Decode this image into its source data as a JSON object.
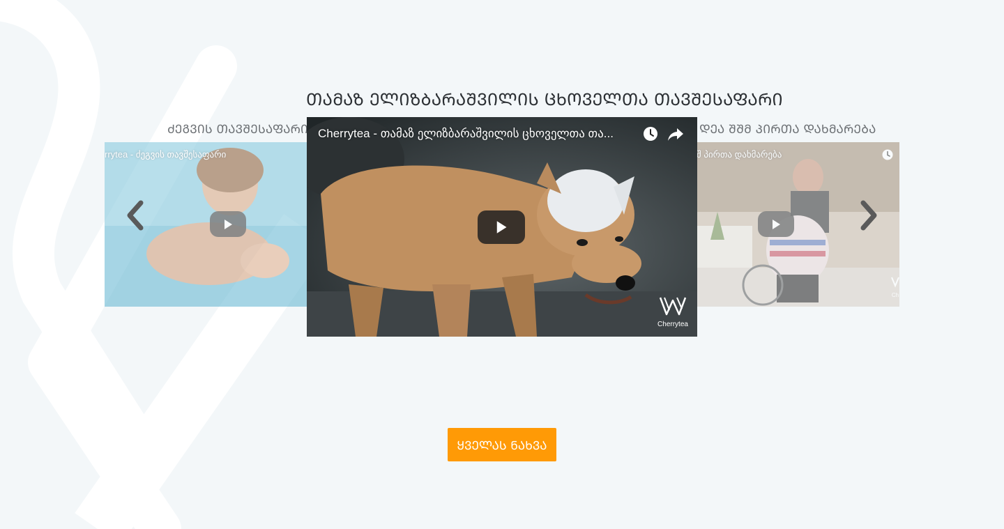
{
  "section": {
    "title": "ᲗᲐᲛᲐᲖ ᲔᲚᲘᲖᲑᲐᲠᲐᲨᲕᲘᲚᲘᲡ ᲪᲮᲝᲕᲔᲚᲗᲐ ᲗᲐᲕᲨᲔᲡᲐᲤᲐᲠᲘ"
  },
  "carousel": {
    "left": {
      "caption": "ᲫᲔᲒᲕᲘᲡ ᲗᲐᲕᲨᲔᲡᲐᲤᲐᲠᲘ",
      "video_title": "rrytea - ძეგვის თავშესაფარი"
    },
    "center": {
      "video_title": "Cherrytea - თამაზ ელიზბარაშვილის ცხოველთა თა...",
      "brand": "Cherrytea"
    },
    "right": {
      "caption": "ᲓᲔᲐ ᲨᲨᲛ ᲞᲘᲠᲗᲐ ᲓᲐᲮᲛᲐᲠᲔᲑᲐ",
      "video_title": "შ პირთა დახმარება",
      "brand": "Ch"
    },
    "prev_icon": "chevron-left-icon",
    "next_icon": "chevron-right-icon"
  },
  "cta": {
    "label": "ᲧᲕᲔᲚᲐᲡ ᲜᲐᲮᲕᲐ"
  },
  "colors": {
    "background": "#f3f7f9",
    "accent": "#ff9a06"
  }
}
